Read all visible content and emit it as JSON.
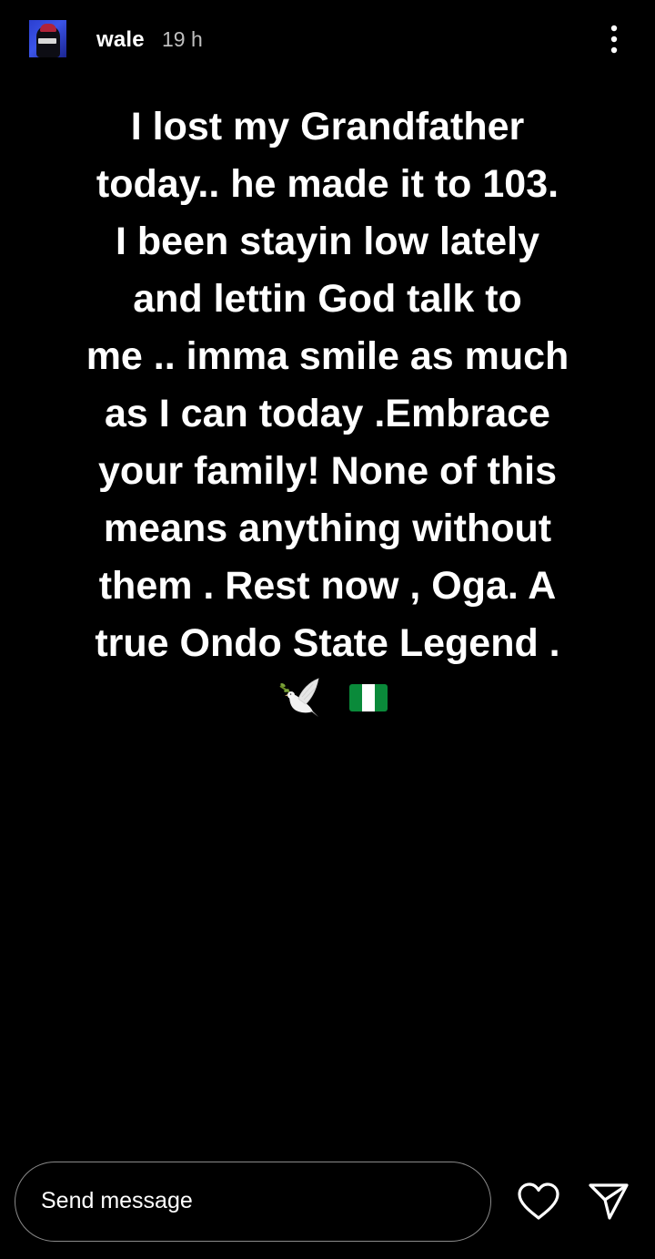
{
  "header": {
    "username": "wale",
    "time": "19 h",
    "avatar_icon": "profile-avatar",
    "more_icon": "more-vertical-icon"
  },
  "story": {
    "lines": [
      "I lost my Grandfather",
      "today.. he made it to 103.",
      "I been stayin low lately",
      "and lettin God talk to",
      "me .. imma smile as much",
      "as I can today .Embrace",
      "your family! None of this",
      "means anything without",
      "them . Rest now , Oga.  A",
      "true Ondo State Legend ."
    ],
    "emojis": [
      "dove-emoji",
      "nigeria-flag-emoji"
    ],
    "background_color": "#000000",
    "text_color": "#ffffff"
  },
  "footer": {
    "message_placeholder": "Send message",
    "like_icon": "heart-icon",
    "share_icon": "paper-plane-icon"
  }
}
